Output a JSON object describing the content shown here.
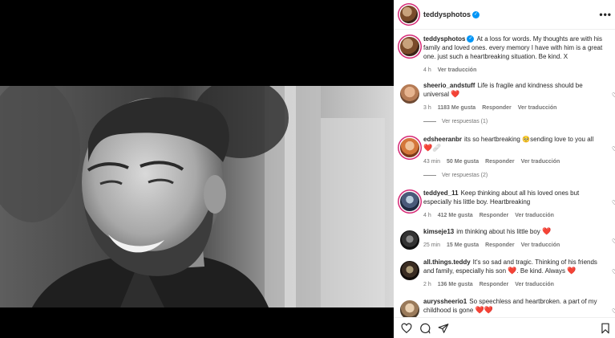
{
  "post": {
    "username": "teddysphotos",
    "more_label": "•••"
  },
  "caption": {
    "username": "teddysphotos",
    "text": "At a loss for words. My thoughts are with his family and loved ones. every memory I have with him is a great one. just such a heartbreaking situation. Be kind. X",
    "time": "4 h",
    "translate": "Ver traducción"
  },
  "comments": [
    {
      "username": "sheerio_andstuff",
      "text": "Life is fragile and kindness should be universal",
      "emoji": "❤️",
      "time": "3 h",
      "likes": "1183 Me gusta",
      "reply": "Responder",
      "translate": "Ver traducción",
      "replies": "Ver respuestas (1)"
    },
    {
      "username": "edsheeranbr",
      "text": "its so heartbreaking",
      "emoji": "🥺",
      "text2": "sending love to you all",
      "emoji2": "❤️🩹",
      "time": "43 min",
      "likes": "50 Me gusta",
      "reply": "Responder",
      "translate": "Ver traducción",
      "replies": "Ver respuestas (2)"
    },
    {
      "username": "teddyed_11",
      "text": "Keep thinking about all his loved ones but especially his little boy. Heartbreaking",
      "time": "4 h",
      "likes": "412 Me gusta",
      "reply": "Responder",
      "translate": "Ver traducción"
    },
    {
      "username": "kimseje13",
      "text": "im thinking about his little boy",
      "emoji": "❤️",
      "time": "25 min",
      "likes": "15 Me gusta",
      "reply": "Responder",
      "translate": "Ver traducción"
    },
    {
      "username": "all.things.teddy",
      "text": "It's so sad and tragic. Thinking of his friends and family, especially his son",
      "emoji": "❤️",
      "text2": ". Be kind. Always",
      "emoji2": "❤️",
      "time": "2 h",
      "likes": "136 Me gusta",
      "reply": "Responder",
      "translate": "Ver traducción"
    },
    {
      "username": "auryssheerio1",
      "text": "So speechless and heartbroken. a part of my childhood is gone",
      "emoji": "❤️❤️"
    }
  ],
  "icons": {
    "verified": "verified-icon",
    "like": "heart-icon",
    "comment": "comment-icon",
    "share": "send-icon",
    "save": "bookmark-icon"
  },
  "colors": {
    "verified": "#0095f6",
    "heart": "#e60023",
    "ring": "#d62976"
  }
}
